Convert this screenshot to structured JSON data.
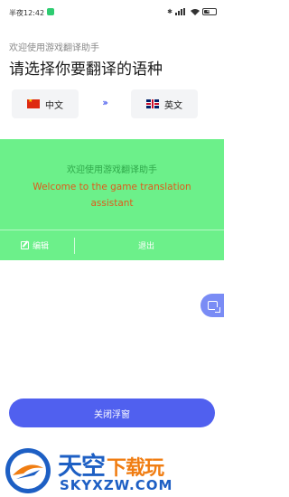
{
  "status_bar": {
    "time": "半夜12:42",
    "battery": "40"
  },
  "header": {
    "subtitle": "欢迎使用游戏翻译助手",
    "title": "请选择你要翻译的语种"
  },
  "language_selector": {
    "source": "中文",
    "target": "英文",
    "swap_glyph": "›››"
  },
  "translation_panel": {
    "source_text": "欢迎使用游戏翻译助手",
    "translated_text": "Welcome to the game translation assistant",
    "edit_label": "编辑",
    "exit_label": "退出",
    "background_color": "#6cf08a"
  },
  "close_button": {
    "label": "关闭浮窗",
    "color": "#5060ef"
  },
  "watermark": {
    "name_blue": "天空",
    "name_orange": "下载玩",
    "domain": "SKYXZW.COM"
  }
}
